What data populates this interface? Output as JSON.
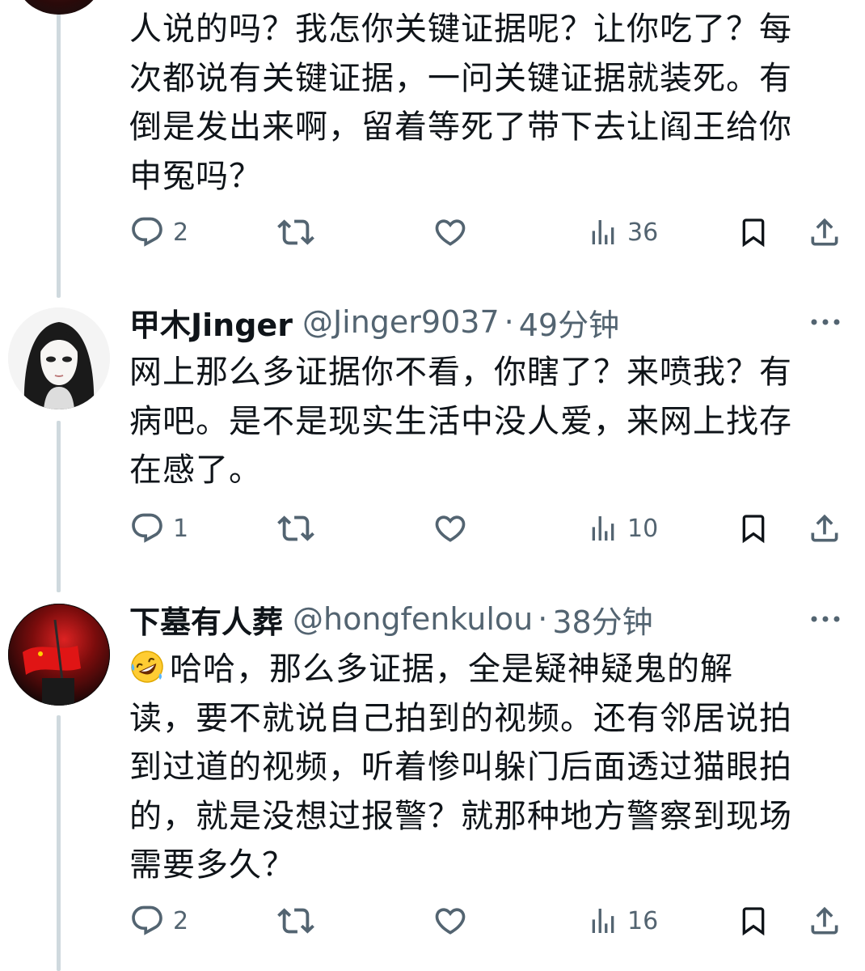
{
  "tweets": [
    {
      "text_lines": [
        "人说的吗？我怎你关键证据呢？让你吃了？每",
        "次都说有关键证据，一问关键证据就装死。有",
        "倒是发出来啊，留着等死了带下去让阎王给你",
        "申冤吗？"
      ],
      "replies": "2",
      "views": "36"
    },
    {
      "display_name": "甲木Jinger",
      "handle": "@Jinger9037",
      "separator": "·",
      "time": "49分钟",
      "text_lines": [
        "网上那么多证据你不看，你瞎了？来喷我？有",
        "病吧。是不是现实生活中没人爱，来网上找存",
        "在感了。"
      ],
      "replies": "1",
      "views": "10"
    },
    {
      "display_name": "下墓有人葬",
      "handle": "@hongfenkulou",
      "separator": "·",
      "time": "38分钟",
      "first_line_after_emoji": "哈哈，那么多证据，全是疑神疑鬼的解",
      "text_lines": [
        "读，要不就说自己拍到的视频。还有邻居说拍",
        "到过道的视频，听着惨叫躲门后面透过猫眼拍",
        "的，就是没想过报警？就那种地方警察到现场",
        "需要多久？"
      ],
      "emoji": "rolling-on-floor-laughing-emoji",
      "replies": "2",
      "views": "16"
    }
  ],
  "icons": {
    "reply": "reply-icon",
    "retweet": "retweet-icon",
    "like": "heart-icon",
    "views": "views-bar-chart-icon",
    "bookmark": "bookmark-icon",
    "share": "share-icon",
    "more": "more-options-icon"
  },
  "colors": {
    "text": "#0f1419",
    "secondary": "#536471",
    "thread_line": "#cfd9de"
  }
}
